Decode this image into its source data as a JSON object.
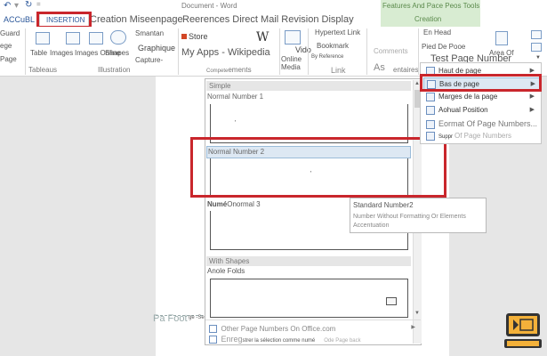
{
  "titlebar": {
    "undo_icon": "undo-arrow",
    "redo_icon": "redo-arrow",
    "doc_title": "Document - Word",
    "context_tab_group": "Features And Pace Peos Tools",
    "context_tab": "Creation"
  },
  "tabs": {
    "home": "ACCuBL",
    "insert": "INSERTION",
    "design": "Creation Miseenpage",
    "rest": "Reerences Direct Mail Revision Display"
  },
  "ribbon": {
    "pages_group_items": [
      "Guard",
      "ege",
      "Page"
    ],
    "table_label": "Table",
    "images_label": "Images",
    "images_online_label": "Images Online",
    "shapes_label": "Shapes",
    "tables_group": "Tableaus",
    "illustrations_group": "Illustration",
    "smartart": "Smantan",
    "graphic": "Graphique",
    "capture": "Capture-",
    "store": "Store",
    "myapps": "My Apps - Wikipedia",
    "wiki_glyph": "W",
    "video": "Vido",
    "online_media": "Online Media",
    "hyperlink": "Hypertext Link",
    "bookmark": "Bookmark",
    "reference": "By Reference",
    "link_group": "Link",
    "comments": "Comments",
    "comments_group": "entaires",
    "complements_group": "ements",
    "header": "En Head",
    "footer": "Pied De Pooe",
    "page_number": "Test Page Number",
    "text_area": "Area Of",
    "as_glyph": "As"
  },
  "menu": {
    "items": [
      {
        "label": "Haut de page",
        "has_arrow": true
      },
      {
        "label": "Bas de page",
        "has_arrow": true
      },
      {
        "label": "Marges de la page",
        "has_arrow": true
      },
      {
        "label": "Aohual Position",
        "has_arrow": true
      },
      {
        "label": "Eormat Of Page Numbers...",
        "has_arrow": false
      },
      {
        "label": "Suppr",
        "has_arrow": false
      }
    ],
    "remove_overlay": "Of Page Numbers"
  },
  "gallery": {
    "section_simple": "Simple",
    "item1": "Normal Number 1",
    "item2": "Normal Number 2",
    "item3_prefix": "Numé",
    "item3": "Onormal 3",
    "section_shapes": "With Shapes",
    "item4": "Anole Folds",
    "more": "Other Page Numbers On Office.com",
    "save_selection": "strer la sélection comme numé",
    "save_prefix": "Enreg",
    "save_suffix": "Ode Page back"
  },
  "tooltip": {
    "title": "Standard Number2",
    "line1": "Number Without Formatting Or Elements",
    "line2": "Accentuation"
  },
  "doc": {
    "footer_label": "Pa Foot",
    "footer_suffix": "ge -Se"
  }
}
